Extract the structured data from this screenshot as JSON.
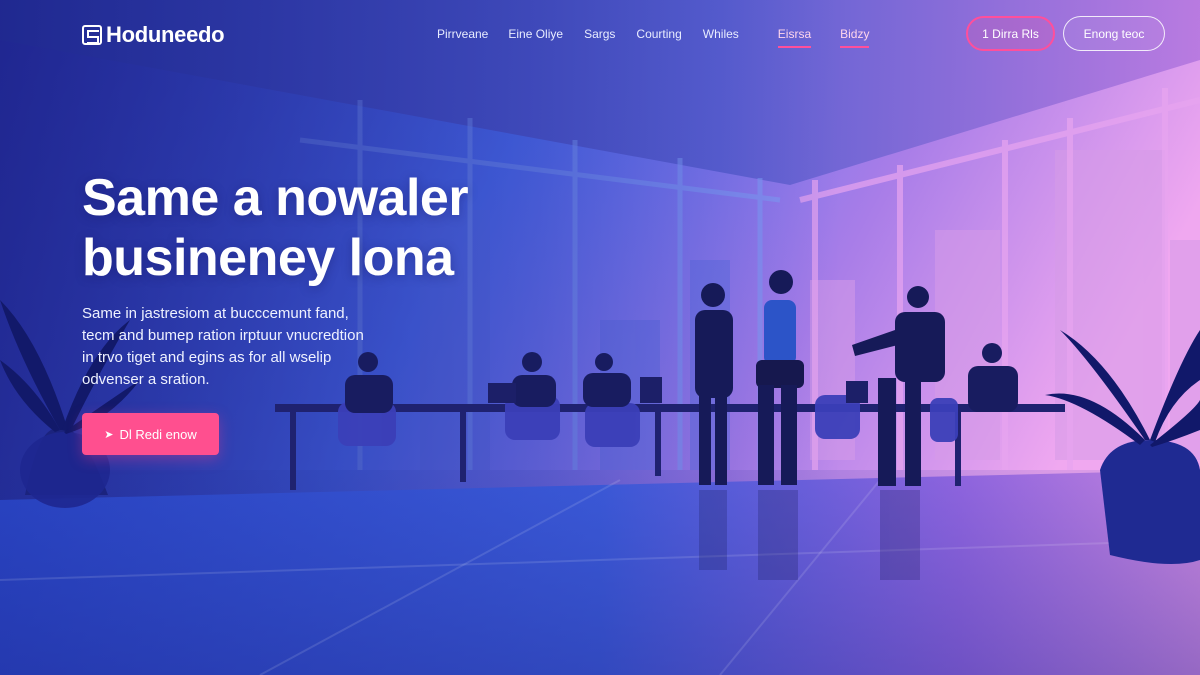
{
  "brand": {
    "name": "Hoduneedo",
    "icon": "logo-mark-icon"
  },
  "nav": {
    "links": [
      "Pirrveane",
      "Eine Oliye",
      "Sargs",
      "Courting",
      "Whiles",
      "Eisrsa",
      "Bidzy"
    ],
    "active_index": [
      5,
      6
    ],
    "accent_color": "#ff4f9b"
  },
  "header_buttons": {
    "primary": "1 Dirra Rls",
    "secondary": "Enong teoc"
  },
  "hero": {
    "title_line1": "Same a nowaler",
    "title_line2": "busineney lona",
    "copy_lines": [
      "Same in jastresiom at bucccemunt fand,",
      "tecm and bumep ration irptuur vnucredtion",
      "in trvo tiget and egins as for all wselip",
      "odvenser a sration."
    ],
    "cta_label": "Dl Redi enow",
    "cta_icon": "arrow-icon",
    "cta_color": "#ff4f8f"
  }
}
